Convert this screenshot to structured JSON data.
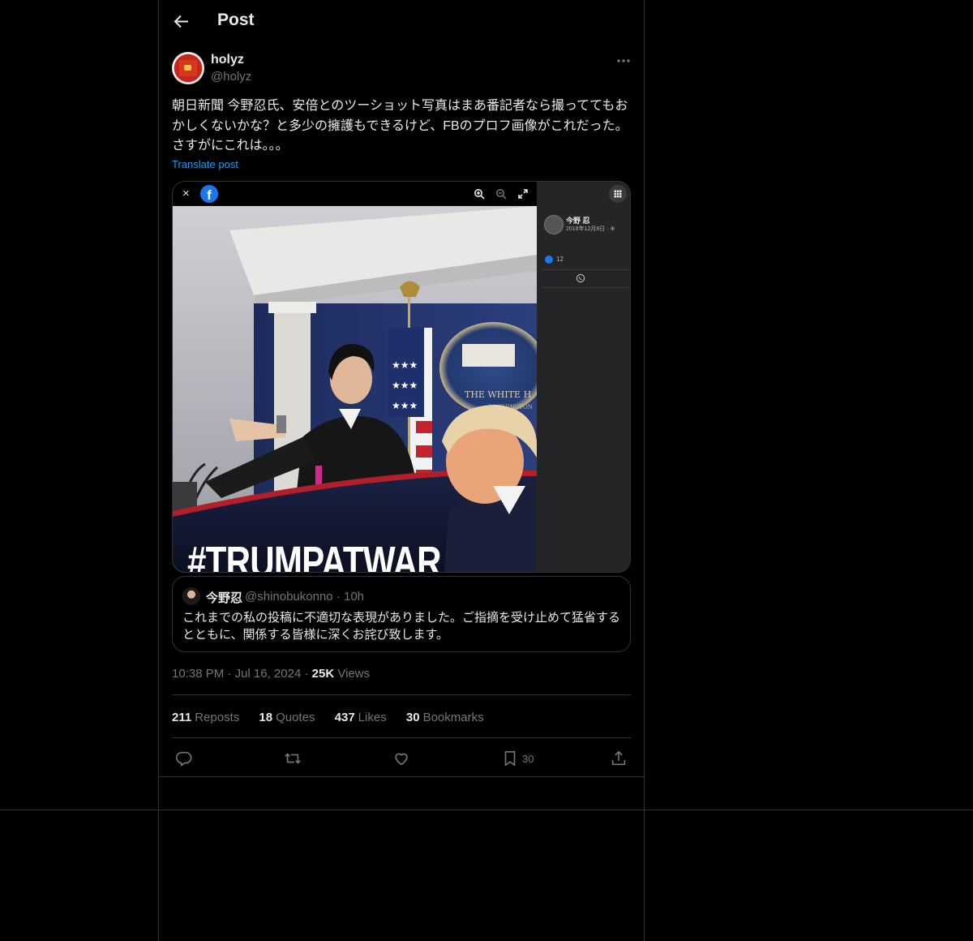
{
  "header": {
    "title": "Post"
  },
  "post": {
    "author_name": "holyz",
    "author_handle": "@holyz",
    "text": "朝日新聞 今野忍氏、安倍とのツーショット写真はまあ番記者なら撮っててもおかしくないかな？と多少の擁護もできるけど、FBのプロフ画像がこれだった。さすがにこれは。。。",
    "translate_label": "Translate post",
    "media": {
      "fb_close": "×",
      "fb_logo": "f",
      "hashtag_text": "#TRUMPATWAR",
      "seal_text": "THE WHITE H",
      "seal_subtext": "WASHINGTON",
      "side_name": "今野 忍",
      "side_date": "2018年12月8日 · ⊕",
      "side_likes": "12"
    },
    "quote": {
      "name": "今野忍",
      "handle_time": "@shinobukonno · 10h",
      "text": "これまでの私の投稿に不適切な表現がありました。ご指摘を受け止めて猛省するとともに、関係する皆様に深くお詫び致します。"
    },
    "meta": {
      "time": "10:38 PM",
      "date": "Jul 16, 2024",
      "views_count": "25K",
      "views_label": "Views"
    },
    "stats": {
      "reposts_count": "211",
      "reposts_label": "Reposts",
      "quotes_count": "18",
      "quotes_label": "Quotes",
      "likes_count": "437",
      "likes_label": "Likes",
      "bookmarks_count": "30",
      "bookmarks_label": "Bookmarks"
    },
    "actions": {
      "bookmark_count": "30"
    }
  },
  "colors": {
    "background": "#000000",
    "text": "#e7e9ea",
    "secondary": "#71767b",
    "accent": "#1d9bf0",
    "border": "#2f3336"
  },
  "icons": [
    "arrow-left-icon",
    "more-icon",
    "reply-icon",
    "repost-icon",
    "like-icon",
    "bookmark-icon",
    "share-icon",
    "facebook-icon",
    "zoom-in-icon",
    "zoom-out-icon",
    "fullscreen-icon",
    "grid-icon",
    "whatsapp-icon"
  ]
}
